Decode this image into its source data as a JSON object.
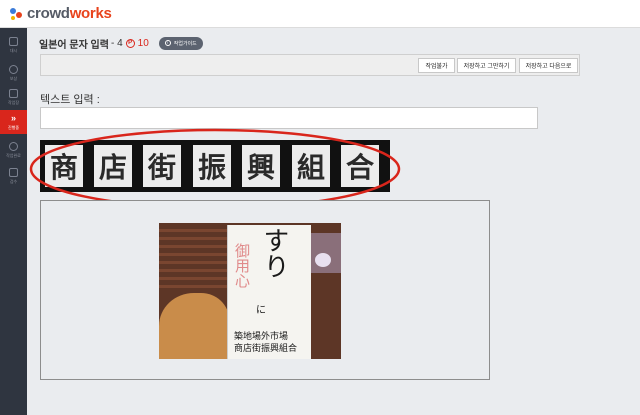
{
  "app": {
    "logo_part1": "crowd",
    "logo_part2": "works"
  },
  "sidebar": {
    "items": [
      {
        "label": "대시",
        "icon": "dashboard-icon"
      },
      {
        "label": "보상",
        "icon": "reward-icon"
      },
      {
        "label": "작업장",
        "icon": "workspace-icon"
      },
      {
        "label": "진행중",
        "icon": "chevron-right-icon"
      },
      {
        "label": "작업완료",
        "icon": "check-icon"
      },
      {
        "label": "검수",
        "icon": "lock-icon"
      }
    ],
    "active_color": "#d9261c"
  },
  "header": {
    "title": "일본어 문자 입력",
    "count": "- 4",
    "point_symbol": "P",
    "points": "10",
    "guide_label": "작업가이드",
    "guide_icon": "info-icon"
  },
  "toolbar": {
    "unable_label": "작업불가",
    "save_stop_label": "저장하고 그만하기",
    "save_next_label": "저장하고 다음으로"
  },
  "input": {
    "label": "텍스트 입력 :",
    "value": "",
    "placeholder": ""
  },
  "text_strip": {
    "characters": [
      "商",
      "店",
      "街",
      "振",
      "興",
      "組",
      "合"
    ],
    "highlight_color": "#d9261c"
  },
  "photo": {
    "big_text": "すり",
    "red_text": "御用心",
    "small_char": "に",
    "line1": "築地場外市場",
    "line2": "商店街振興組合"
  }
}
